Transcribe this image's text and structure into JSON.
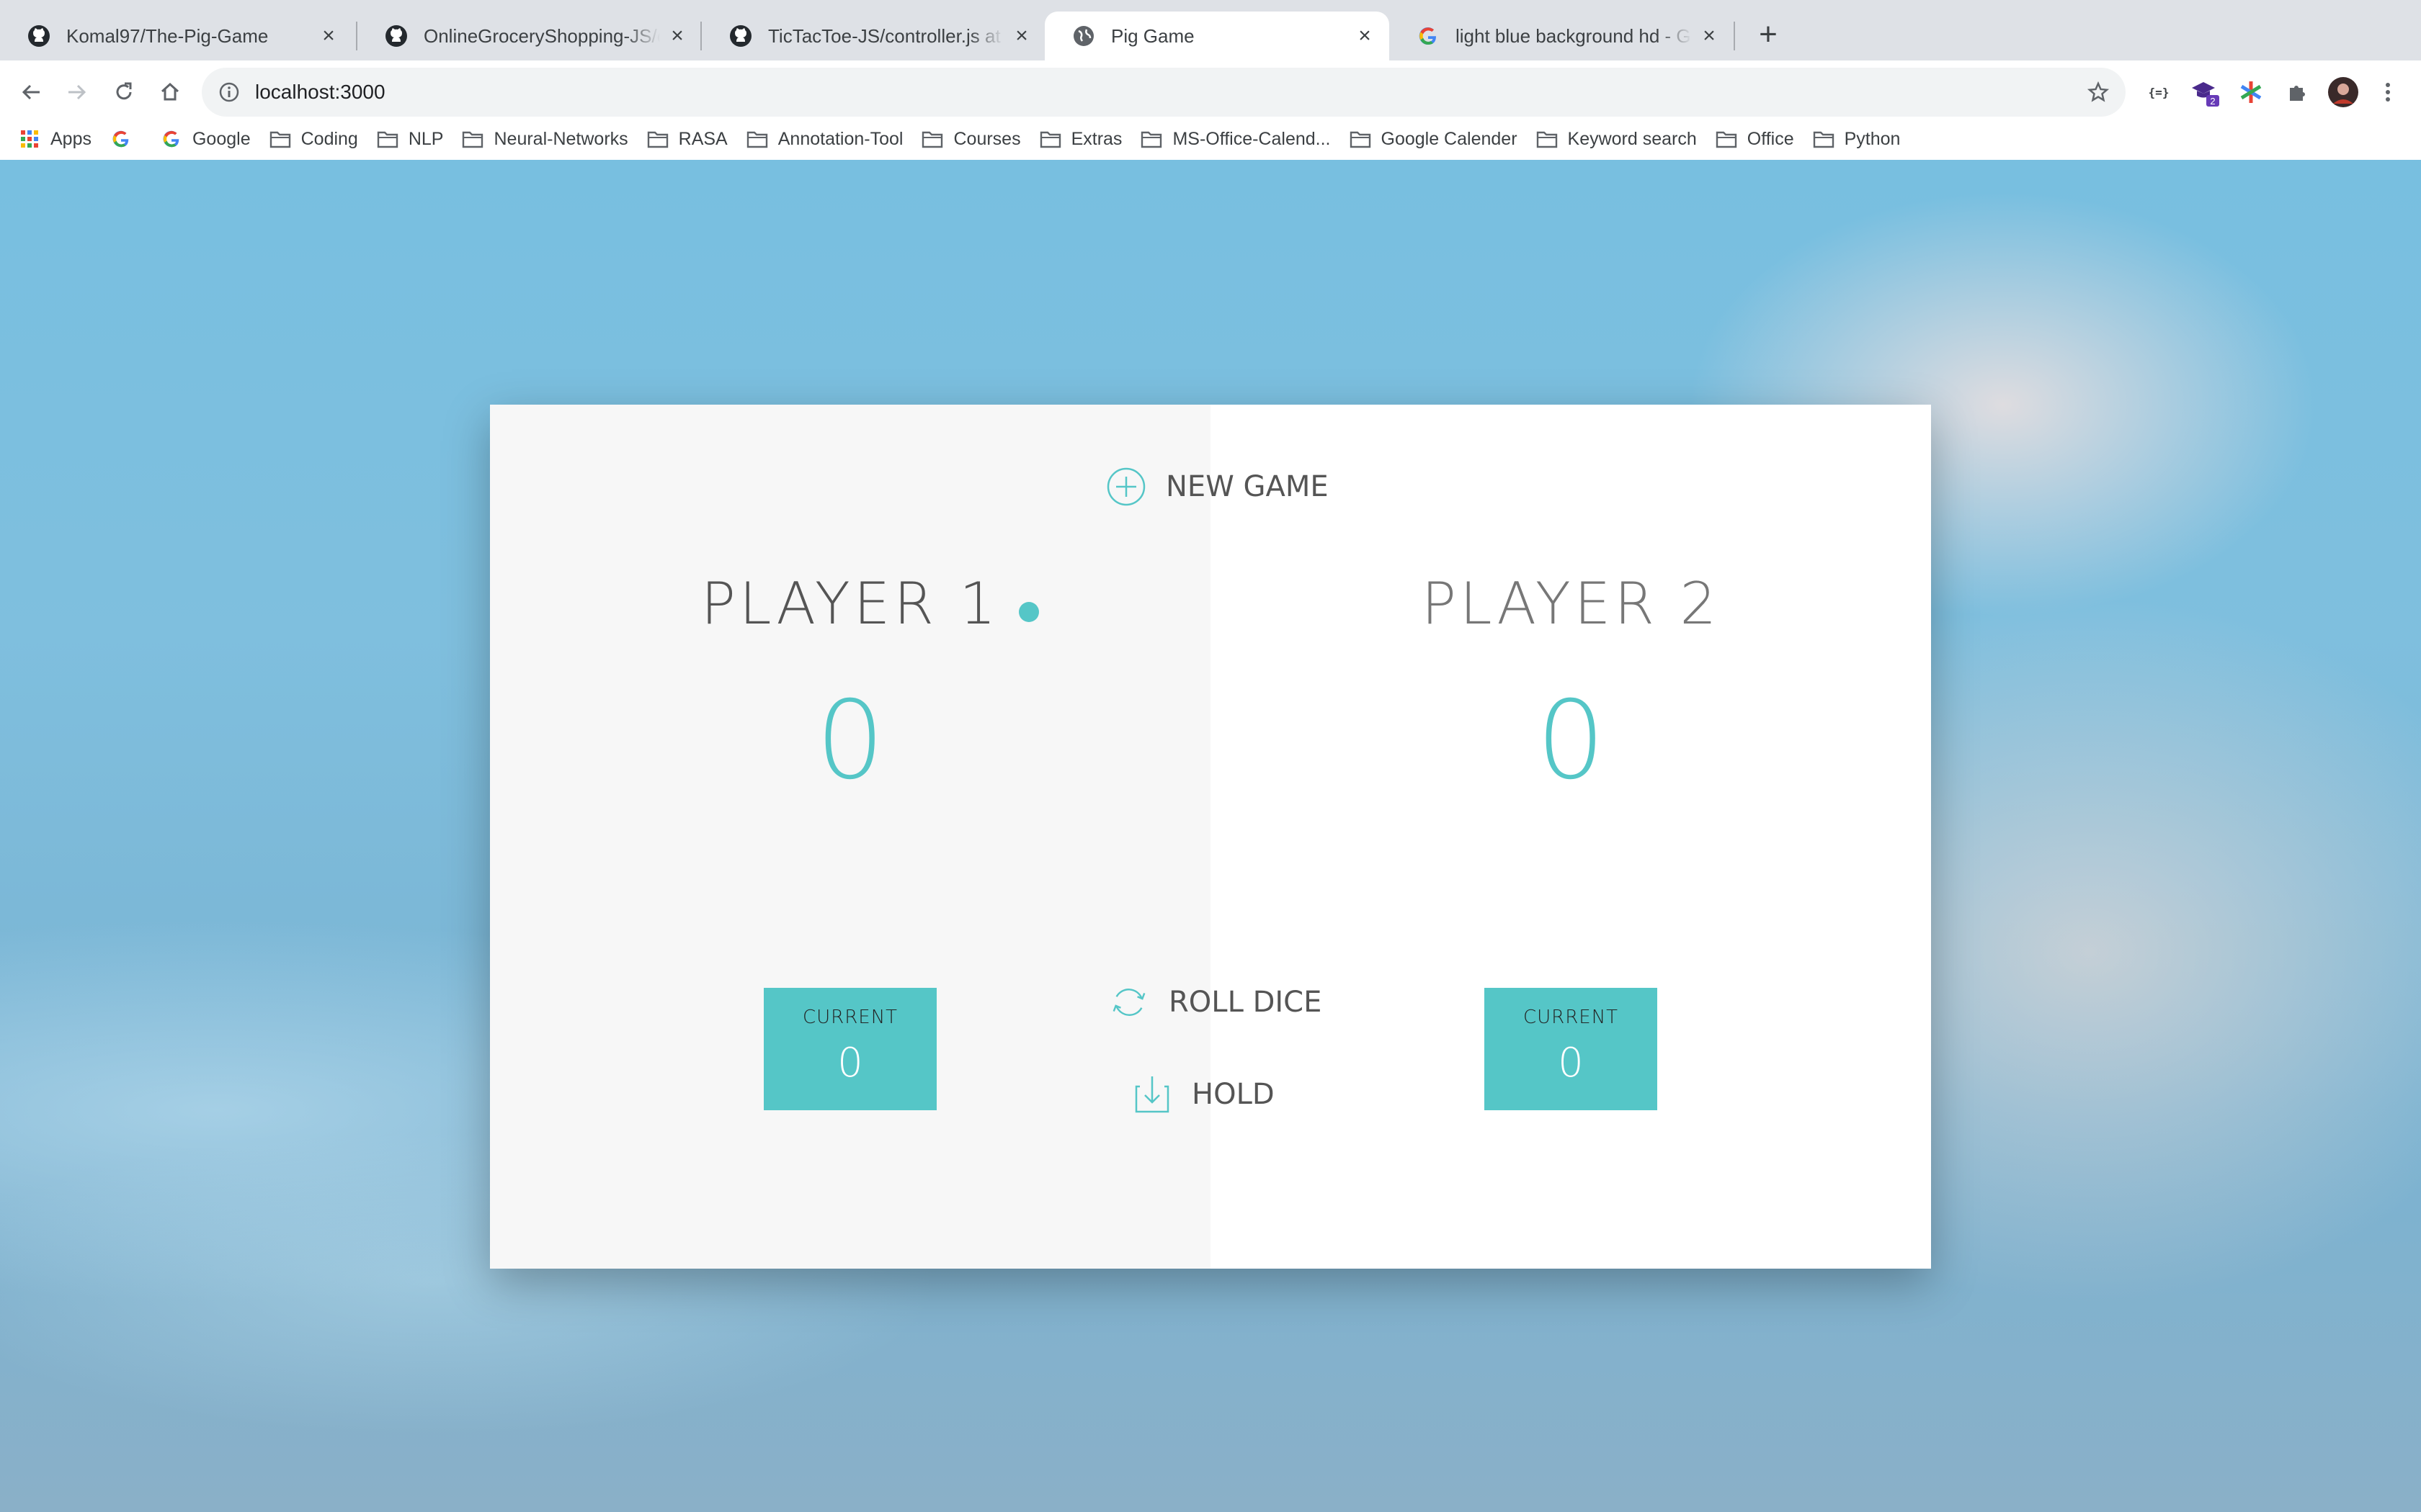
{
  "browser": {
    "tabs": [
      {
        "title": "Komal97/The-Pig-Game",
        "favicon": "github-icon",
        "active": false
      },
      {
        "title": "OnlineGroceryShopping-JS/co",
        "favicon": "github-icon",
        "active": false
      },
      {
        "title": "TicTacToe-JS/controller.js at m",
        "favicon": "github-icon",
        "active": false
      },
      {
        "title": "Pig Game",
        "favicon": "globe-icon",
        "active": true
      },
      {
        "title": "light blue background hd - Goo",
        "favicon": "google-icon",
        "active": false
      }
    ],
    "url": "localhost:3000",
    "extension_badge": "2",
    "bookmarks": [
      {
        "label": "Apps",
        "icon": "apps-grid-icon"
      },
      {
        "label": "",
        "icon": "google-icon"
      },
      {
        "label": "Google",
        "icon": "google-icon"
      },
      {
        "label": "Coding",
        "icon": "folder-icon"
      },
      {
        "label": "NLP",
        "icon": "folder-icon"
      },
      {
        "label": "Neural-Networks",
        "icon": "folder-icon"
      },
      {
        "label": "RASA",
        "icon": "folder-icon"
      },
      {
        "label": "Annotation-Tool",
        "icon": "folder-icon"
      },
      {
        "label": "Courses",
        "icon": "folder-icon"
      },
      {
        "label": "Extras",
        "icon": "folder-icon"
      },
      {
        "label": "MS-Office-Calend...",
        "icon": "folder-icon"
      },
      {
        "label": "Google Calender",
        "icon": "folder-icon"
      },
      {
        "label": "Keyword search",
        "icon": "folder-icon"
      },
      {
        "label": "Office",
        "icon": "folder-icon"
      },
      {
        "label": "Python",
        "icon": "folder-icon"
      }
    ]
  },
  "game": {
    "new_game_label": "NEW GAME",
    "roll_dice_label": "ROLL DICE",
    "hold_label": "HOLD",
    "current_label": "CURRENT",
    "active_player": 1,
    "accent_color": "#55c6c7",
    "players": [
      {
        "name": "PLAYER 1",
        "score": "0",
        "current": "0"
      },
      {
        "name": "PLAYER 2",
        "score": "0",
        "current": "0"
      }
    ]
  }
}
